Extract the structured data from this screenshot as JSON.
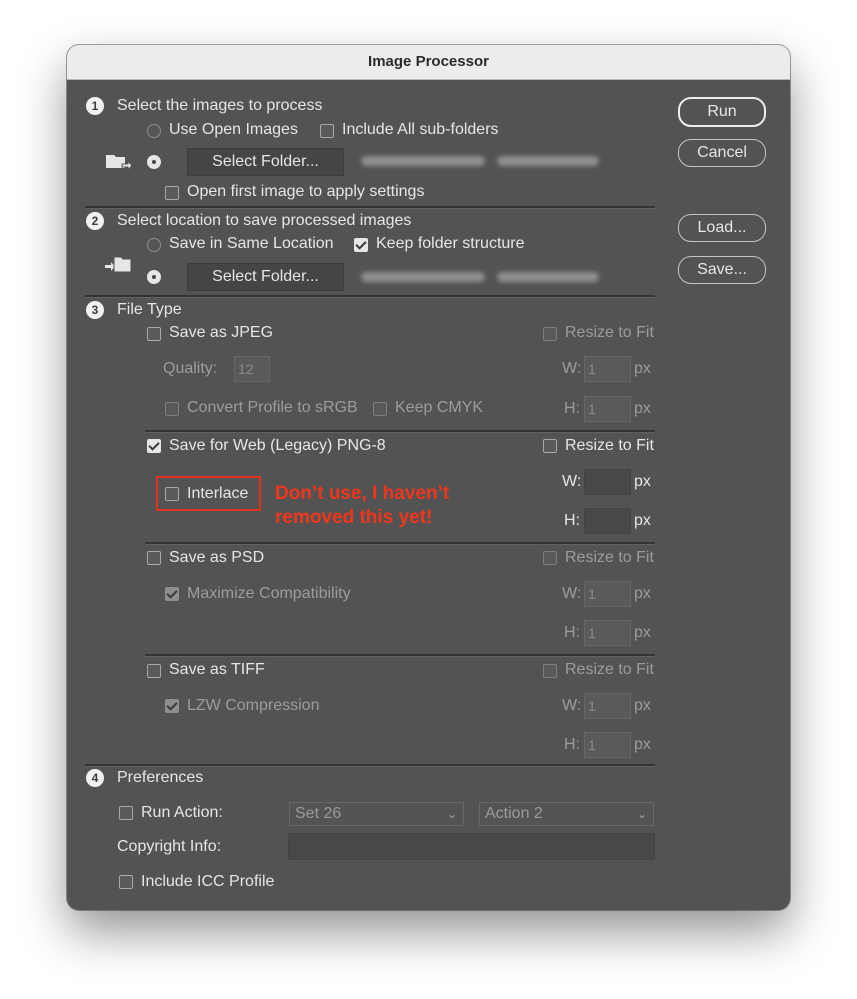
{
  "window": {
    "title": "Image Processor"
  },
  "buttons": {
    "run": "Run",
    "cancel": "Cancel",
    "load": "Load...",
    "save": "Save..."
  },
  "section1": {
    "number": "1",
    "heading": "Select the images to process",
    "use_open_images": "Use Open Images",
    "include_subfolders": "Include All sub-folders",
    "select_folder": "Select Folder...",
    "open_first_image": "Open first image to apply settings"
  },
  "section2": {
    "number": "2",
    "heading": "Select location to save processed images",
    "save_same_location": "Save in Same Location",
    "keep_folder_structure": "Keep folder structure",
    "select_folder": "Select Folder..."
  },
  "section3": {
    "number": "3",
    "heading": "File Type",
    "jpeg": {
      "label": "Save as JPEG",
      "resize": "Resize to Fit",
      "quality_label": "Quality:",
      "quality_value": "12",
      "w_label": "W:",
      "w_value": "1",
      "h_label": "H:",
      "h_value": "1",
      "px": "px",
      "convert_profile": "Convert Profile to sRGB",
      "keep_cmyk": "Keep CMYK"
    },
    "png": {
      "label": "Save for Web (Legacy) PNG-8",
      "resize": "Resize to Fit",
      "interlace": "Interlace",
      "w_label": "W:",
      "w_value": "",
      "h_label": "H:",
      "h_value": "",
      "px": "px"
    },
    "psd": {
      "label": "Save as PSD",
      "resize": "Resize to Fit",
      "maximize": "Maximize Compatibility",
      "w_label": "W:",
      "w_value": "1",
      "h_label": "H:",
      "h_value": "1",
      "px": "px"
    },
    "tiff": {
      "label": "Save as TIFF",
      "resize": "Resize to Fit",
      "lzw": "LZW Compression",
      "w_label": "W:",
      "w_value": "1",
      "h_label": "H:",
      "h_value": "1",
      "px": "px"
    }
  },
  "section4": {
    "number": "4",
    "heading": "Preferences",
    "run_action": "Run Action:",
    "action_set": "Set 26",
    "action_name": "Action 2",
    "copyright_label": "Copyright Info:",
    "copyright_value": "",
    "include_icc": "Include ICC Profile"
  },
  "annotation": {
    "line1": "Don’t use, I haven’t",
    "line2": "removed this yet!",
    "color": "#e1321e"
  }
}
